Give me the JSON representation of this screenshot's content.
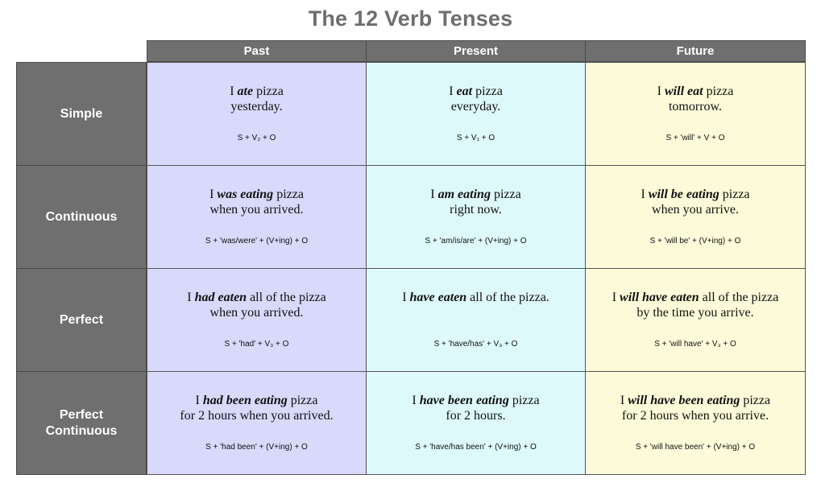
{
  "title": "The 12 Verb Tenses",
  "columns": [
    "Past",
    "Present",
    "Future"
  ],
  "rows": [
    {
      "label": "Simple",
      "cells": [
        {
          "pre": "I ",
          "verb": "ate",
          "post": " pizza",
          "line2": "yesterday.",
          "formula": "S + V₂ + O"
        },
        {
          "pre": "I ",
          "verb": "eat",
          "post": " pizza",
          "line2": "everyday.",
          "formula": "S + V₁ + O"
        },
        {
          "pre": "I ",
          "verb": "will eat",
          "post": " pizza",
          "line2": "tomorrow.",
          "formula": "S + 'will' + V + O"
        }
      ]
    },
    {
      "label": "Continuous",
      "cells": [
        {
          "pre": "I ",
          "verb": "was eating",
          "post": " pizza",
          "line2": "when you arrived.",
          "formula": "S + 'was/were' + (V+ing) + O"
        },
        {
          "pre": "I ",
          "verb": "am eating",
          "post": " pizza",
          "line2": "right now.",
          "formula": "S + 'am/is/are' + (V+ing) + O"
        },
        {
          "pre": "I ",
          "verb": "will be eating",
          "post": " pizza",
          "line2": "when you arrive.",
          "formula": "S + 'will be' + (V+ing) + O"
        }
      ]
    },
    {
      "label": "Perfect",
      "cells": [
        {
          "pre": "I ",
          "verb": "had eaten",
          "post": " all of the pizza",
          "line2": "when you arrived.",
          "formula": "S + 'had' + V₃ + O"
        },
        {
          "pre": "I ",
          "verb": "have eaten",
          "post": " all of the pizza.",
          "line2": "",
          "formula": "S + 'have/has' + V₃ + O"
        },
        {
          "pre": "I ",
          "verb": "will have eaten",
          "post": " all of the pizza",
          "line2": "by the time you arrive.",
          "formula": "S + 'will have' + V₃ + O"
        }
      ]
    },
    {
      "label": "Perfect Continuous",
      "cells": [
        {
          "pre": "I ",
          "verb": "had been eating",
          "post": " pizza",
          "line2": "for 2 hours when you arrived.",
          "formula": "S + 'had been' + (V+ing) + O"
        },
        {
          "pre": "I ",
          "verb": "have been eating",
          "post": " pizza",
          "line2": "for 2 hours.",
          "formula": "S + 'have/has been' + (V+ing) + O"
        },
        {
          "pre": "I ",
          "verb": "will have been eating",
          "post": " pizza",
          "line2": "for 2 hours when you arrive.",
          "formula": "S + 'will have been' + (V+ing) + O"
        }
      ]
    }
  ]
}
